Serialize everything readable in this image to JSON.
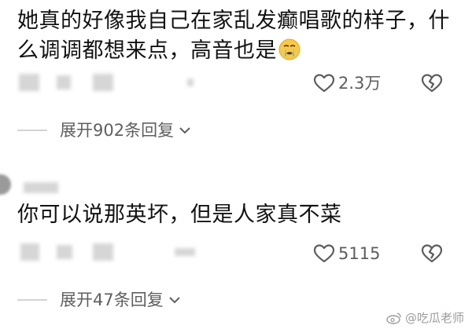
{
  "comments": [
    {
      "text": "她真的好像我自己在家乱发癫唱歌的样子，什么调调都想来点，高音也是",
      "emoji_icon": "crying-face-icon",
      "likes": "2.3万",
      "replies_label": "展开902条回复"
    },
    {
      "text": "你可以说那英坏，但是人家真不菜",
      "likes": "5115",
      "replies_label": "展开47条回复"
    }
  ],
  "watermark": {
    "text": "@吃瓜老师",
    "icon": "weibo-logo-icon"
  },
  "colors": {
    "text": "#121212",
    "meta": "#5d5d5d",
    "blur": "#d6d6d6"
  }
}
